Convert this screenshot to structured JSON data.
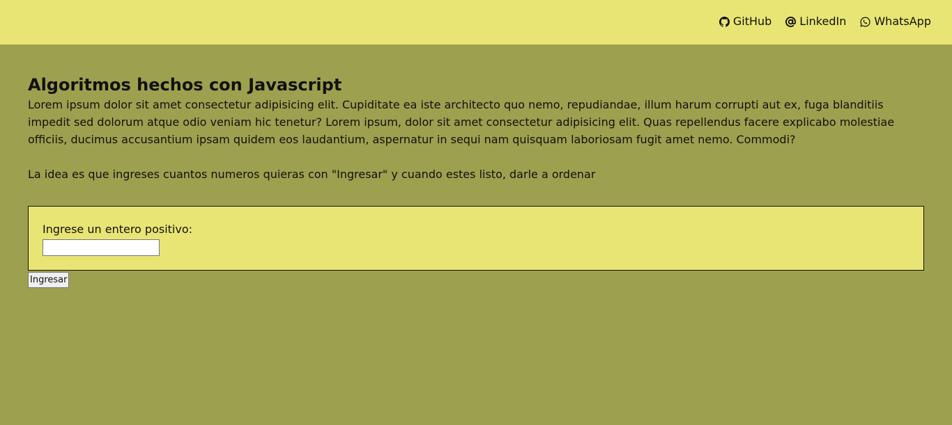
{
  "nav": {
    "items": [
      {
        "label": "GitHub",
        "icon": "github-icon"
      },
      {
        "label": "LinkedIn",
        "icon": "at-icon"
      },
      {
        "label": "WhatsApp",
        "icon": "whatsapp-icon"
      }
    ]
  },
  "main": {
    "title": "Algoritmos hechos con Javascript",
    "intro": "Lorem ipsum dolor sit amet consectetur adipisicing elit. Cupiditate ea iste architecto quo nemo, repudiandae, illum harum corrupti aut ex, fuga blanditiis impedit sed dolorum atque odio veniam hic tenetur? Lorem ipsum, dolor sit amet consectetur adipisicing elit. Quas repellendus facere explicabo molestiae officiis, ducimus accusantium ipsam quidem eos laudantium, aspernatur in sequi nam quisquam laboriosam fugit amet nemo. Commodi?",
    "instructions": "La idea es que ingreses cuantos numeros quieras con \"Ingresar\" y cuando estes listo, darle a ordenar"
  },
  "form": {
    "label": "Ingrese un entero positivo:",
    "value": "",
    "placeholder": "",
    "submit_label": "Ingresar"
  },
  "colors": {
    "background": "#9da04f",
    "header": "#e8e575",
    "card": "#e8e575"
  }
}
